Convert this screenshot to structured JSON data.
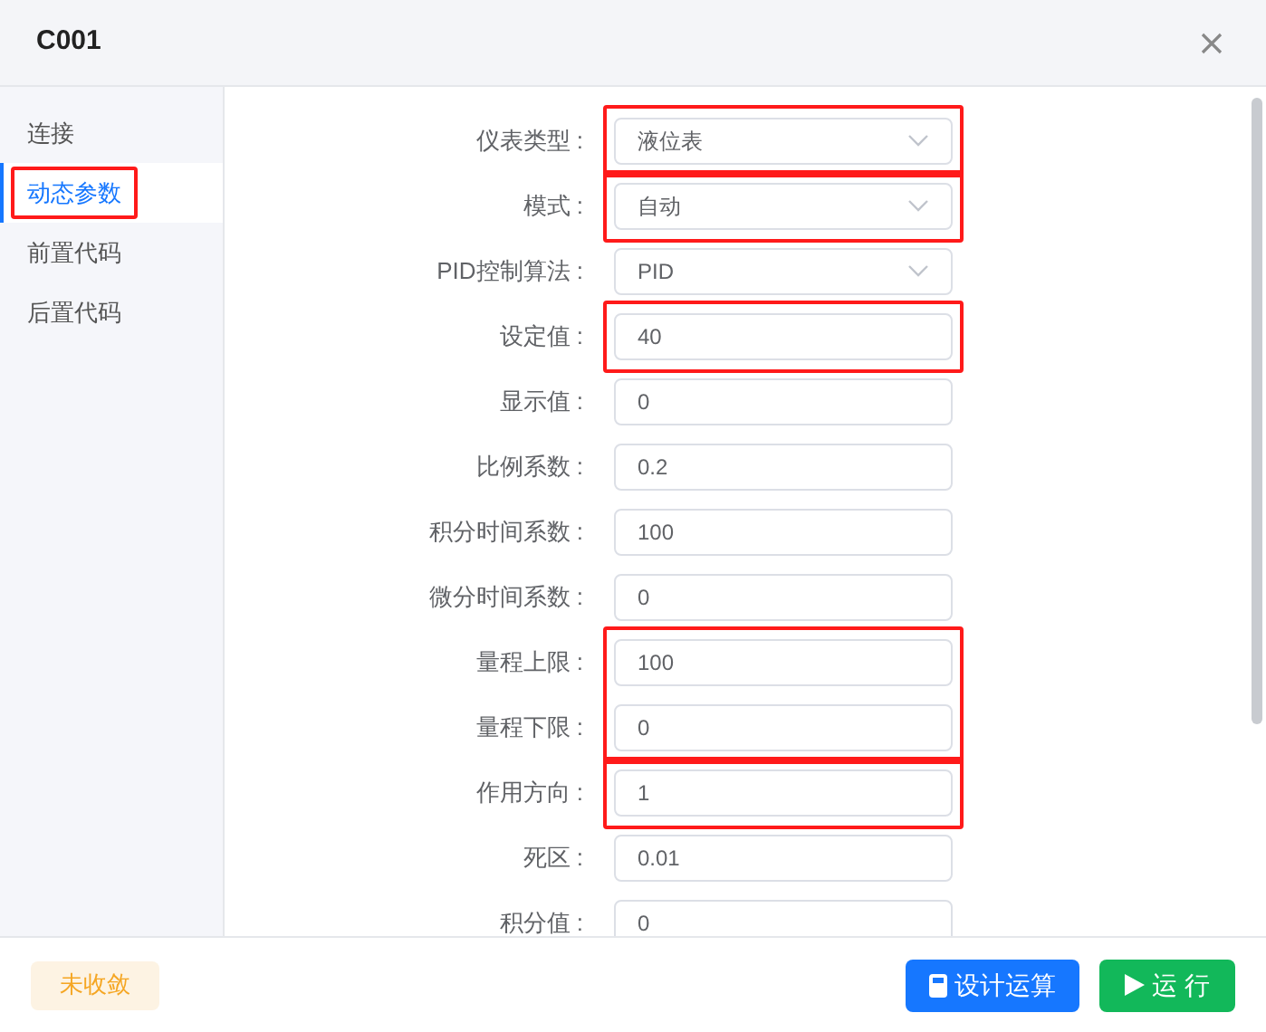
{
  "dialog": {
    "title": "C001"
  },
  "sidebar": {
    "items": [
      {
        "label": "连接",
        "selected": false,
        "highlighted": false
      },
      {
        "label": "动态参数",
        "selected": true,
        "highlighted": true
      },
      {
        "label": "前置代码",
        "selected": false,
        "highlighted": false
      },
      {
        "label": "后置代码",
        "selected": false,
        "highlighted": false
      }
    ]
  },
  "form": {
    "groups": [
      {
        "highlighted": true,
        "fields": [
          {
            "label": "仪表类型 :",
            "kind": "select",
            "value": "液位表"
          }
        ]
      },
      {
        "highlighted": true,
        "fields": [
          {
            "label": "模式 :",
            "kind": "select",
            "value": "自动"
          }
        ]
      },
      {
        "highlighted": false,
        "fields": [
          {
            "label": "PID控制算法 :",
            "kind": "select",
            "value": "PID"
          }
        ]
      },
      {
        "highlighted": true,
        "fields": [
          {
            "label": "设定值 :",
            "kind": "input",
            "value": "40"
          }
        ]
      },
      {
        "highlighted": false,
        "fields": [
          {
            "label": "显示值 :",
            "kind": "input",
            "value": "0"
          }
        ]
      },
      {
        "highlighted": false,
        "fields": [
          {
            "label": "比例系数 :",
            "kind": "input",
            "value": "0.2"
          }
        ]
      },
      {
        "highlighted": false,
        "fields": [
          {
            "label": "积分时间系数 :",
            "kind": "input",
            "value": "100"
          }
        ]
      },
      {
        "highlighted": false,
        "fields": [
          {
            "label": "微分时间系数 :",
            "kind": "input",
            "value": "0"
          }
        ]
      },
      {
        "highlighted": true,
        "fields": [
          {
            "label": "量程上限 :",
            "kind": "input",
            "value": "100"
          },
          {
            "label": "量程下限 :",
            "kind": "input",
            "value": "0"
          }
        ]
      },
      {
        "highlighted": true,
        "fields": [
          {
            "label": "作用方向 :",
            "kind": "input",
            "value": "1"
          }
        ]
      },
      {
        "highlighted": false,
        "fields": [
          {
            "label": "死区 :",
            "kind": "input",
            "value": "0.01"
          }
        ]
      },
      {
        "highlighted": false,
        "fields": [
          {
            "label": "积分值 :",
            "kind": "input",
            "value": "0"
          }
        ]
      }
    ]
  },
  "footer": {
    "status": "未收敛",
    "buttons": [
      {
        "label": "设计运算",
        "kind": "design"
      },
      {
        "label": "运 行",
        "kind": "run"
      }
    ]
  }
}
